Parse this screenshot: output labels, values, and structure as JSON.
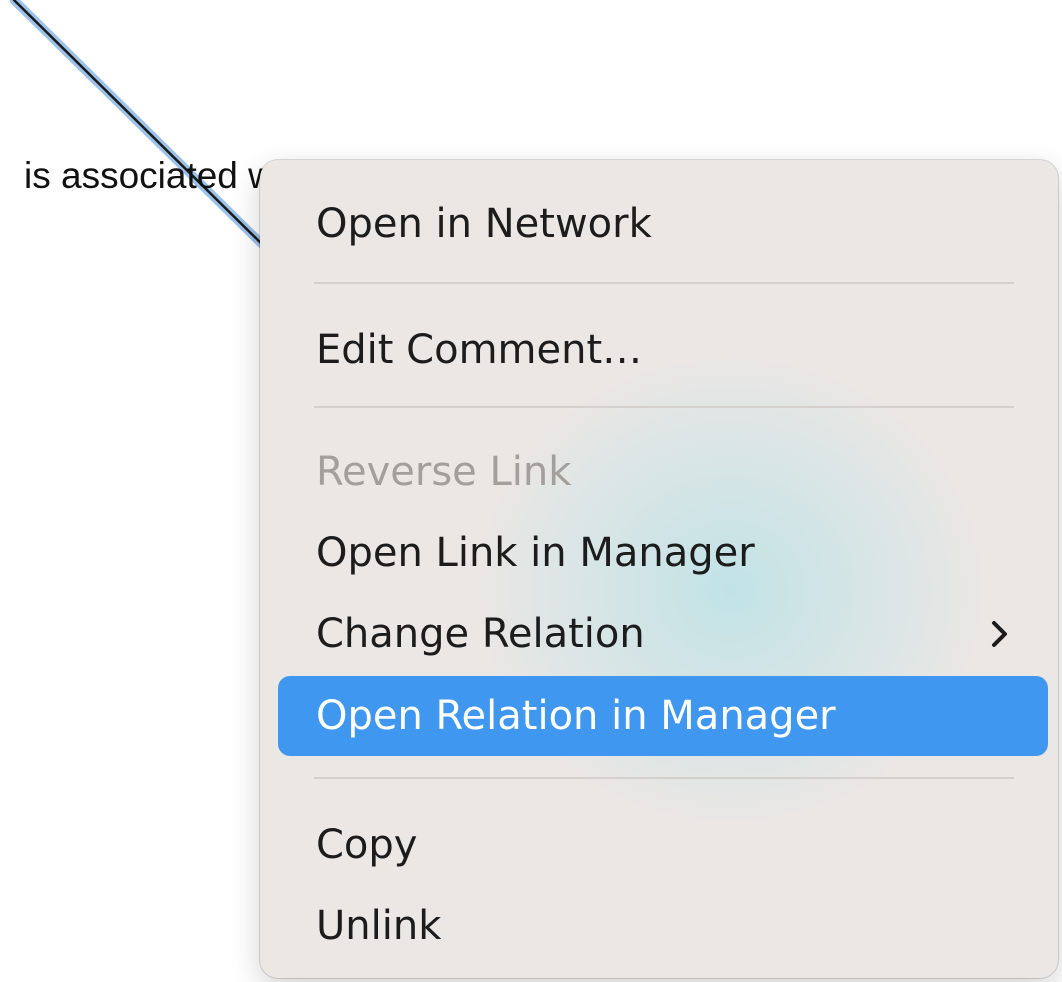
{
  "canvas": {
    "link_label": "is associated with"
  },
  "context_menu": {
    "items": [
      {
        "label": "Open in Network",
        "enabled": true
      },
      {
        "label": "Edit Comment…",
        "enabled": true
      },
      {
        "label": "Reverse Link",
        "enabled": false
      },
      {
        "label": "Open Link in Manager",
        "enabled": true
      },
      {
        "label": "Change Relation",
        "enabled": true,
        "has_submenu": true,
        "submenu_icon": "chevron-right-icon"
      },
      {
        "label": "Open Relation in Manager",
        "enabled": true,
        "highlighted": true
      },
      {
        "label": "Copy",
        "enabled": true
      },
      {
        "label": "Unlink",
        "enabled": true
      }
    ]
  },
  "colors": {
    "menu_background": "#ebe7e5",
    "highlight": "#3f97f0",
    "disabled_text": "#a39f9d",
    "link_line": "#1a1a1a",
    "link_line_selection": "#9cc1ea"
  }
}
